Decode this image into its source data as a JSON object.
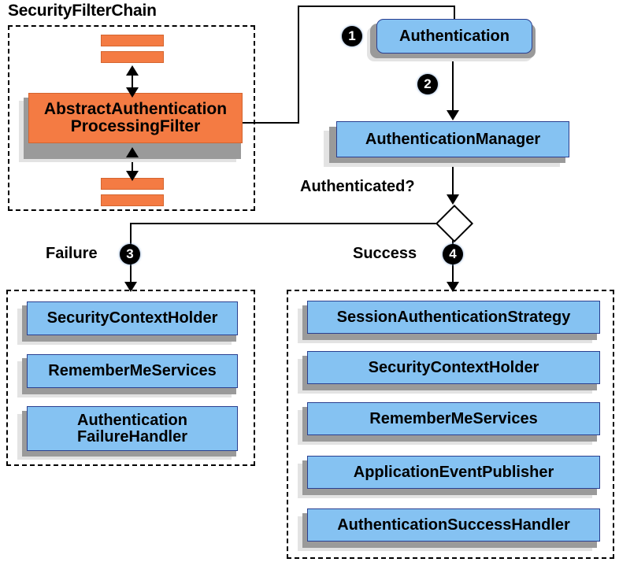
{
  "diagram": {
    "title_visible": false
  },
  "groups": {
    "filter_chain": {
      "title": "SecurityFilterChain"
    },
    "failure_group": {
      "title": ""
    },
    "success_group": {
      "title": ""
    }
  },
  "filter_chain": {
    "bars": [
      {
        "name": "filter-bar-top-1"
      },
      {
        "name": "filter-bar-top-2"
      },
      {
        "name": "filter-bar-bottom-1"
      },
      {
        "name": "filter-bar-bottom-2"
      }
    ],
    "main_filter": {
      "line1": "AbstractAuthentication",
      "line2": "ProcessingFilter"
    }
  },
  "flow": {
    "authentication": "Authentication",
    "authentication_manager": "AuthenticationManager",
    "decision_label": "Authenticated?",
    "failure_label": "Failure",
    "success_label": "Success",
    "badges": {
      "step1": "1",
      "step2": "2",
      "step3": "3",
      "step4": "4"
    }
  },
  "failure_branch": {
    "items": [
      {
        "line1": "SecurityContextHolder",
        "line2": ""
      },
      {
        "line1": "RememberMeServices",
        "line2": ""
      },
      {
        "line1": "Authentication",
        "line2": "FailureHandler"
      }
    ]
  },
  "success_branch": {
    "items": [
      {
        "line1": "SessionAuthenticationStrategy"
      },
      {
        "line1": "SecurityContextHolder"
      },
      {
        "line1": "RememberMeServices"
      },
      {
        "line1": "ApplicationEventPublisher"
      },
      {
        "line1": "AuthenticationSuccessHandler"
      }
    ]
  },
  "colors": {
    "node_blue": "#85C2F2",
    "node_orange": "#F47B43",
    "shadow_dark": "#9a9a9a",
    "shadow_light": "#e3e3e3",
    "stroke": "#000000",
    "background": "#ffffff"
  }
}
